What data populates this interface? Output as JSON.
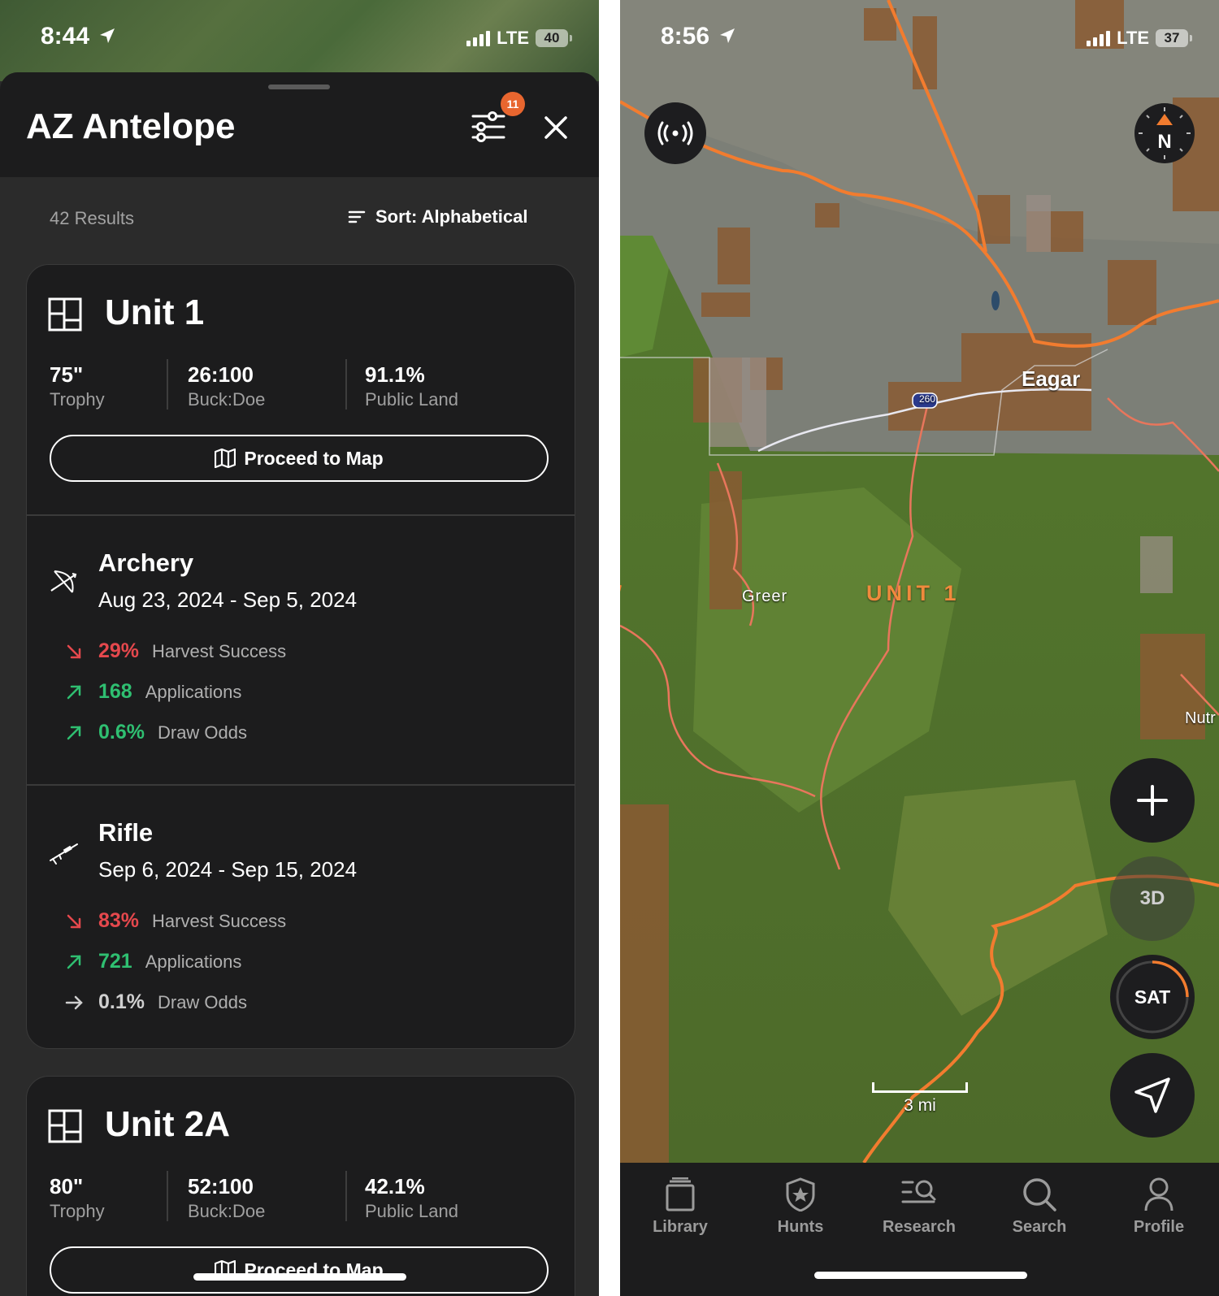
{
  "left": {
    "status": {
      "time": "8:44",
      "network": "LTE",
      "battery": "40"
    },
    "title": "AZ Antelope",
    "filter_badge": "11",
    "results_count": "42 Results",
    "sort_label": "Sort: Alphabetical",
    "units": [
      {
        "name": "Unit 1",
        "stats": [
          {
            "value": "75\"",
            "label": "Trophy"
          },
          {
            "value": "26:100",
            "label": "Buck:Doe"
          },
          {
            "value": "91.1%",
            "label": "Public Land"
          }
        ],
        "proceed_label": "Proceed to Map",
        "seasons": [
          {
            "name": "Archery",
            "icon": "bow-arrow-icon",
            "dates": "Aug 23, 2024 - Sep 5, 2024",
            "metrics": [
              {
                "trend": "down",
                "value": "29%",
                "label": "Harvest Success",
                "color": "#e5484d"
              },
              {
                "trend": "up",
                "value": "168",
                "label": "Applications",
                "color": "#2fbf71"
              },
              {
                "trend": "up",
                "value": "0.6%",
                "label": "Draw Odds",
                "color": "#2fbf71"
              }
            ]
          },
          {
            "name": "Rifle",
            "icon": "rifle-icon",
            "dates": "Sep 6, 2024 - Sep 15, 2024",
            "metrics": [
              {
                "trend": "down",
                "value": "83%",
                "label": "Harvest Success",
                "color": "#e5484d"
              },
              {
                "trend": "up",
                "value": "721",
                "label": "Applications",
                "color": "#2fbf71"
              },
              {
                "trend": "flat",
                "value": "0.1%",
                "label": "Draw Odds",
                "color": "#cfcfcf"
              }
            ]
          }
        ]
      },
      {
        "name": "Unit 2A",
        "stats": [
          {
            "value": "80\"",
            "label": "Trophy"
          },
          {
            "value": "52:100",
            "label": "Buck:Doe"
          },
          {
            "value": "42.1%",
            "label": "Public Land"
          }
        ],
        "proceed_label": "Proceed to Map"
      }
    ]
  },
  "right": {
    "status": {
      "time": "8:56",
      "network": "LTE",
      "battery": "37"
    },
    "map_labels": {
      "town1": "Eagar",
      "town2": "Greer",
      "town3": "Nutr",
      "route": "260",
      "unit": "UNIT 1"
    },
    "compass_label": "N",
    "buttons": {
      "zoom_in": "+",
      "three_d": "3D",
      "sat": "SAT"
    },
    "scale_label": "3 mi",
    "tabs": [
      {
        "label": "Library",
        "icon": "library-icon"
      },
      {
        "label": "Hunts",
        "icon": "shield-star-icon"
      },
      {
        "label": "Research",
        "icon": "research-icon"
      },
      {
        "label": "Search",
        "icon": "search-icon"
      },
      {
        "label": "Profile",
        "icon": "profile-icon"
      }
    ],
    "accent_color": "#f27c2f"
  }
}
